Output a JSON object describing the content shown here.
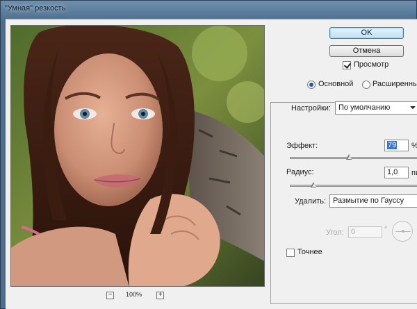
{
  "window": {
    "title": "\"Умная\" резкость"
  },
  "preview": {
    "zoom_out_icon": "minus-icon",
    "zoom_in_icon": "plus-icon",
    "zoom_out_label": "−",
    "zoom_in_label": "+",
    "zoom": "100%"
  },
  "buttons": {
    "ok": "OK",
    "cancel": "Отмена"
  },
  "preview_toggle": {
    "label": "Просмотр",
    "checked": true
  },
  "mode": {
    "options": [
      "Основной",
      "Расширенный"
    ],
    "selected": "Основной"
  },
  "settings": {
    "label": "Настройки:",
    "value": "По умолчанию"
  },
  "effect": {
    "label": "Эффект:",
    "value": "79",
    "unit": "%",
    "slider_level": 0.18
  },
  "radius": {
    "label": "Радиус:",
    "value": "1,0",
    "unit": "пи",
    "slider_level": 0.04
  },
  "remove": {
    "label": "Удалить:",
    "value": "Размытие по Гауссу"
  },
  "angle": {
    "label": "Угол:",
    "value": "0",
    "unit": "°"
  },
  "more_accurate": {
    "label": "Точнее",
    "checked": false
  },
  "colors": {
    "accent": "#3875d7",
    "titlebar": "#6e8fae"
  }
}
